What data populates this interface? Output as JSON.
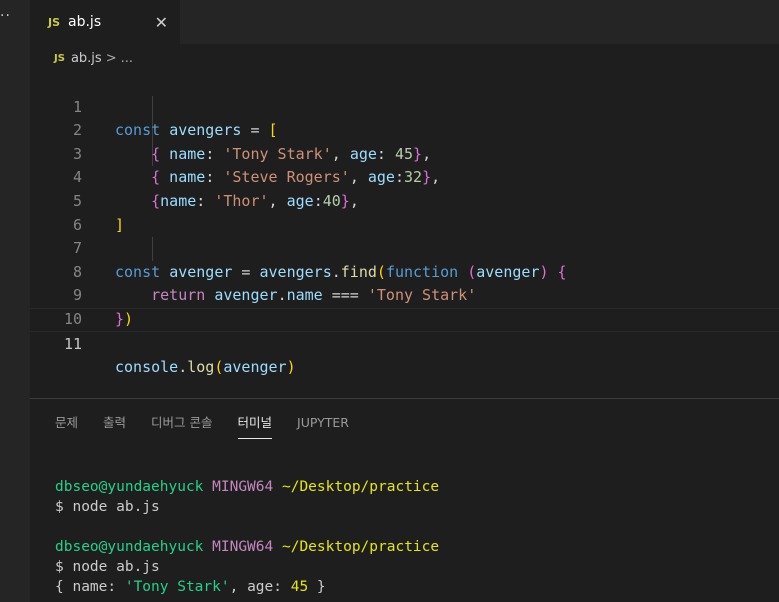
{
  "tab": {
    "badge": "JS",
    "filename": "ab.js",
    "close": "✕"
  },
  "breadcrumb": {
    "badge": "JS",
    "file": "ab.js",
    "separator": ">",
    "more": "..."
  },
  "editor": {
    "line_numbers": [
      "1",
      "2",
      "3",
      "4",
      "5",
      "6",
      "7",
      "8",
      "9",
      "10",
      "11"
    ],
    "current_line": "11",
    "code": {
      "l1": {
        "const": "const",
        "name": "avengers",
        "eq": " = ",
        "open": "["
      },
      "l2": {
        "open": "{",
        "key1": " name",
        "colon1": ": ",
        "val1": "'Tony Stark'",
        "comma": ", ",
        "key2": "age",
        "colon2": ": ",
        "val2": "45",
        "close": "}",
        "end": ","
      },
      "l3": {
        "open": "{",
        "key1": " name",
        "colon1": ": ",
        "val1": "'Steve Rogers'",
        "comma": ", ",
        "key2": "age",
        "colon2": ":",
        "val2": "32",
        "close": "}",
        "end": ","
      },
      "l4": {
        "open": "{",
        "key1": "name",
        "colon1": ": ",
        "val1": "'Thor'",
        "comma": ", ",
        "key2": "age",
        "colon2": ":",
        "val2": "40",
        "close": "}",
        "end": ","
      },
      "l5": {
        "close": "]"
      },
      "l7": {
        "const": "const",
        "name": "avenger",
        "eq": " = ",
        "obj": "avengers",
        "dot": ".",
        "method": "find",
        "paren": "(",
        "fnkw": "function",
        "space": " ",
        "paren2": "(",
        "param": "avenger",
        "paren2c": ")",
        "space2": " ",
        "brace": "{"
      },
      "l8": {
        "ret": "return",
        "obj": " avenger",
        "dot": ".",
        "prop": "name",
        "op": " === ",
        "str": "'Tony Stark'"
      },
      "l9": {
        "brace": "}",
        "paren": ")"
      },
      "l11": {
        "obj": "console",
        "dot": ".",
        "method": "log",
        "paren": "(",
        "arg": "avenger",
        "parenc": ")"
      }
    }
  },
  "panel": {
    "tabs": [
      "문제",
      "출력",
      "디버그 콘솔",
      "터미널",
      "JUPYTER"
    ],
    "active_tab": "터미널"
  },
  "terminal": {
    "user": "dbseo@yundaehyuck",
    "env": "MINGW64",
    "path": "~/Desktop/practice",
    "cmd1": "$ node ab.js",
    "cmd2": "$ node ab.js",
    "out_open": "{ name: ",
    "out_name": "'Tony Stark'",
    "out_mid": ", age: ",
    "out_age": "45",
    "out_close": " }"
  },
  "colors": {
    "accent_yellow": "#cbcb41",
    "prompt_green": "#23d18b",
    "prompt_purple": "#c586c0",
    "path_yellow": "#e5e510"
  }
}
